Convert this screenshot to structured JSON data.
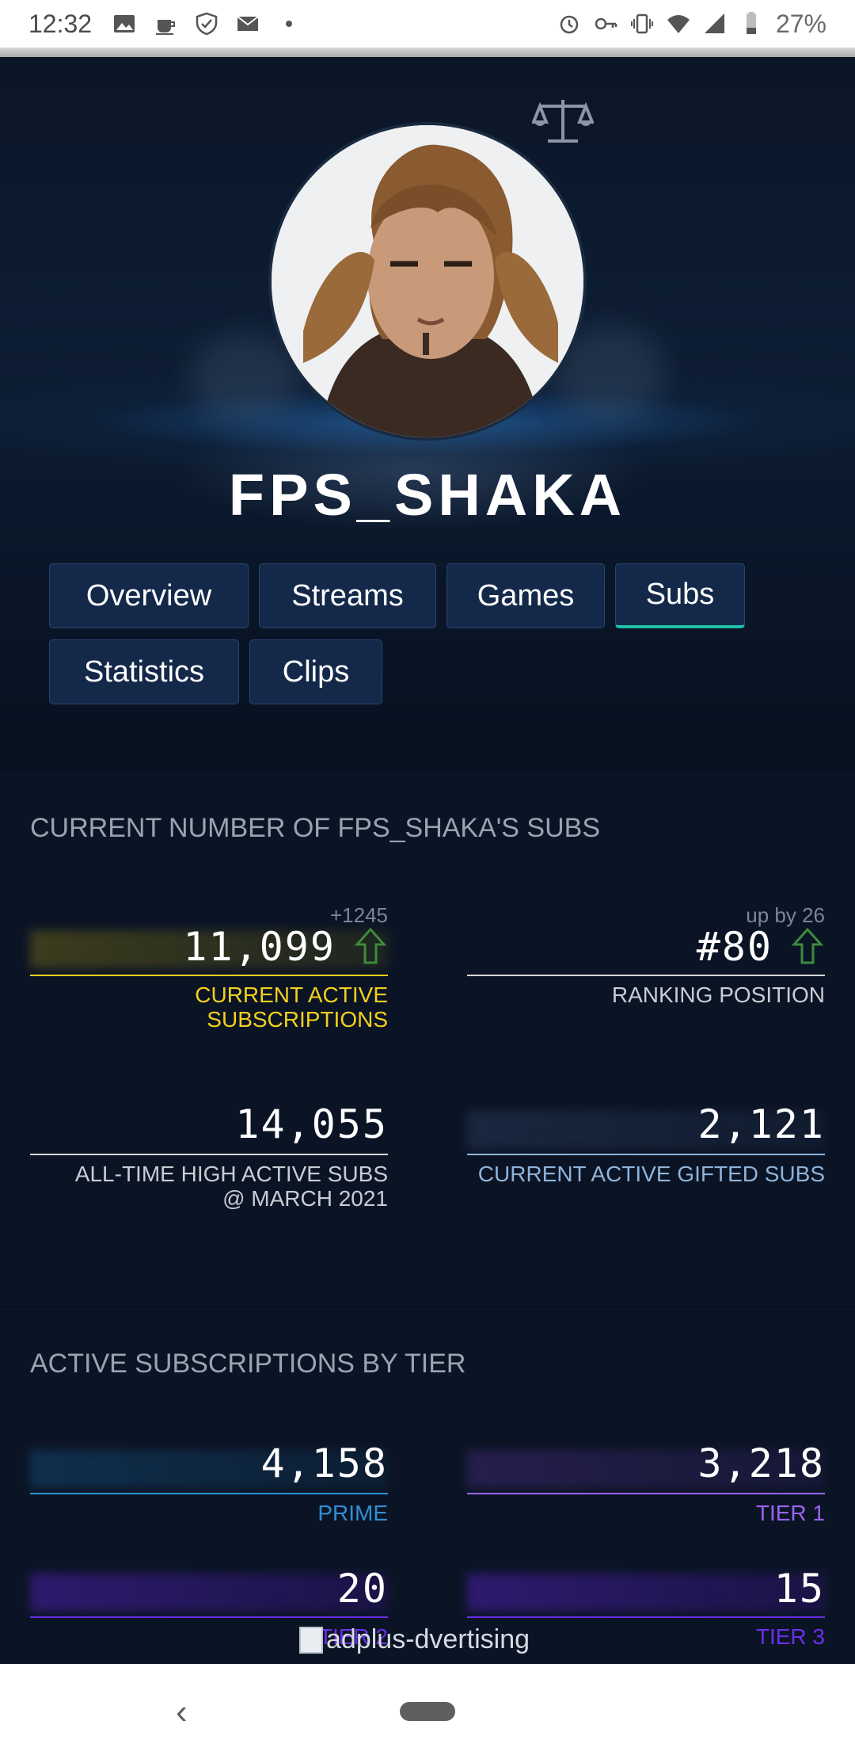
{
  "status_bar": {
    "time": "12:32",
    "battery": "27%",
    "left_icons": [
      "image-icon",
      "coffee-icon",
      "shield-check-icon",
      "mail-icon",
      "dot-icon"
    ],
    "right_icons": [
      "alarm-icon",
      "key-icon",
      "vibrate-icon",
      "wifi-icon",
      "signal-icon",
      "battery-icon"
    ]
  },
  "profile": {
    "username": "FPS_SHAKA",
    "compare_icon": "scale-icon",
    "avatar_alt": "avatar"
  },
  "tabs": [
    {
      "label": "Overview",
      "active": false
    },
    {
      "label": "Streams",
      "active": false
    },
    {
      "label": "Games",
      "active": false
    },
    {
      "label": "Subs",
      "active": true
    },
    {
      "label": "Statistics",
      "active": false
    },
    {
      "label": "Clips",
      "active": false
    }
  ],
  "subs_section": {
    "title": "CURRENT NUMBER OF FPS_SHAKA'S SUBS",
    "current_active": {
      "value": "11,099",
      "delta": "+1245",
      "label_line1": "CURRENT ACTIVE",
      "label_line2": "SUBSCRIPTIONS",
      "trend": "up"
    },
    "ranking": {
      "value": "#80",
      "delta": "up by 26",
      "label": "RANKING POSITION",
      "trend": "up"
    },
    "all_time_high": {
      "value": "14,055",
      "label_line1": "ALL-TIME HIGH ACTIVE SUBS",
      "label_line2": "@ MARCH 2021"
    },
    "gifted": {
      "value": "2,121",
      "label": "CURRENT ACTIVE GIFTED SUBS"
    }
  },
  "tier_section": {
    "title": "ACTIVE SUBSCRIPTIONS BY TIER",
    "prime": {
      "value": "4,158",
      "label": "PRIME"
    },
    "tier1": {
      "value": "3,218",
      "label": "TIER 1"
    },
    "tier2": {
      "value": "20",
      "label": "TIER 2"
    },
    "tier3": {
      "value": "15",
      "label": "TIER 3"
    }
  },
  "ad": {
    "text": "adplus-dvertising"
  },
  "colors": {
    "accent_teal": "#1fc1a8",
    "current_active_yellow": "#f2d01c",
    "gifted_blue": "#8fb3d9",
    "prime_blue": "#2f8fd6",
    "tier_purple": "#9a63f0",
    "tier_deep_purple": "#6b2ee8",
    "trend_green": "#3e8a3e"
  },
  "nav": {
    "back_icon": "back-chevron-icon",
    "home_icon": "home-pill-icon"
  }
}
